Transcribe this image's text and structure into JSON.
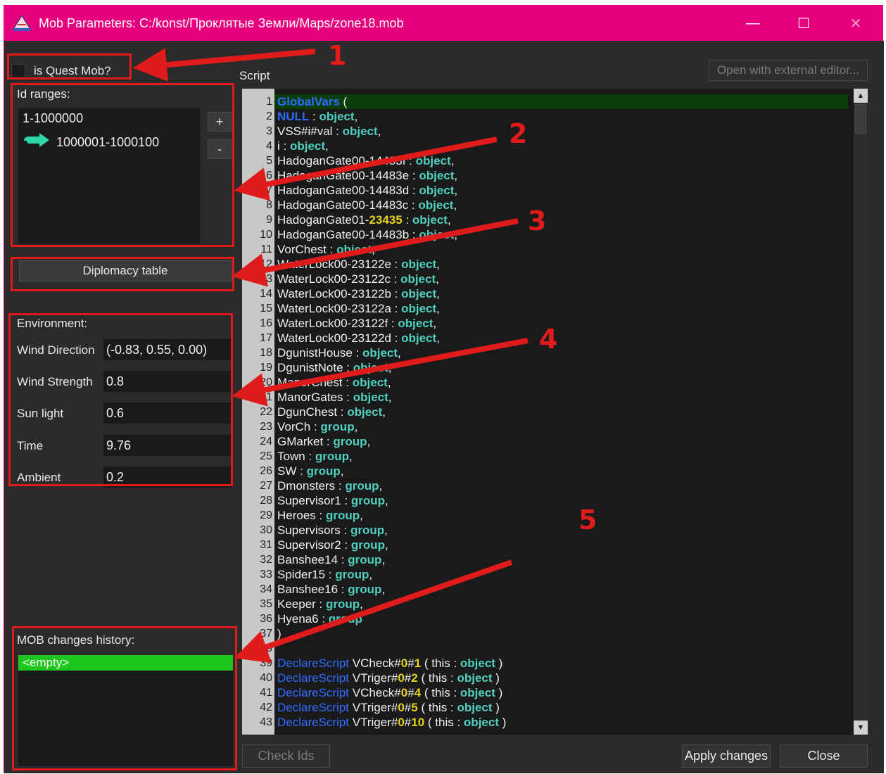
{
  "window": {
    "title": "Mob Parameters: C:/konst/Проклятые Земли/Maps/zone18.mob",
    "controls": {
      "minimize": "—",
      "maximize": "☐",
      "close": "✕"
    },
    "frame_color": "#e6007e"
  },
  "quest": {
    "label": "is Quest Mob?",
    "checked": false
  },
  "id_ranges": {
    "label": "Id ranges:",
    "items": [
      "1-1000000",
      "1000001-1000100"
    ],
    "add_label": "+",
    "remove_label": "-"
  },
  "diplomacy": {
    "label": "Diplomacy table"
  },
  "environment": {
    "label": "Environment:",
    "fields": [
      {
        "label": "Wind Direction",
        "value": "(-0.83, 0.55, 0.00)"
      },
      {
        "label": "Wind Strength",
        "value": "0.8"
      },
      {
        "label": "Sun light",
        "value": "0.6"
      },
      {
        "label": "Time",
        "value": "9.76"
      },
      {
        "label": "Ambient",
        "value": "0.2"
      }
    ]
  },
  "history": {
    "label": "MOB changes history:",
    "items": [
      "<empty>"
    ],
    "selected_color": "#1ec71e"
  },
  "script": {
    "label": "Script",
    "external_editor_label": "Open with external editor...",
    "lines": [
      {
        "n": "1",
        "parts": [
          [
            "kw-blue",
            "GlobalVars"
          ],
          [
            "",
            " ("
          ]
        ]
      },
      {
        "n": "2",
        "parts": [
          [
            "",
            " "
          ],
          [
            "kw-blue",
            "NULL"
          ],
          [
            "",
            " : "
          ],
          [
            "kw-type",
            "object"
          ],
          [
            "",
            ","
          ]
        ]
      },
      {
        "n": "3",
        "parts": [
          [
            "",
            " VSS#i#val : "
          ],
          [
            "kw-type",
            "object"
          ],
          [
            "",
            ","
          ]
        ]
      },
      {
        "n": "4",
        "parts": [
          [
            "",
            " i : "
          ],
          [
            "kw-type",
            "object"
          ],
          [
            "",
            ","
          ]
        ]
      },
      {
        "n": "5",
        "parts": [
          [
            "",
            " HadoganGate00-14483f : "
          ],
          [
            "kw-type",
            "object"
          ],
          [
            "",
            ","
          ]
        ]
      },
      {
        "n": "6",
        "parts": [
          [
            "",
            " HadoganGate00-14483e : "
          ],
          [
            "kw-type",
            "object"
          ],
          [
            "",
            ","
          ]
        ]
      },
      {
        "n": "7",
        "parts": [
          [
            "",
            " HadoganGate00-14483d : "
          ],
          [
            "kw-type",
            "object"
          ],
          [
            "",
            ","
          ]
        ]
      },
      {
        "n": "8",
        "parts": [
          [
            "",
            " HadoganGate00-14483c : "
          ],
          [
            "kw-type",
            "object"
          ],
          [
            "",
            ","
          ]
        ]
      },
      {
        "n": "9",
        "parts": [
          [
            "",
            " HadoganGate01-"
          ],
          [
            "kw-num",
            "23435"
          ],
          [
            "",
            " : "
          ],
          [
            "kw-type",
            "object"
          ],
          [
            "",
            ","
          ]
        ]
      },
      {
        "n": "10",
        "parts": [
          [
            "",
            " HadoganGate00-14483b : "
          ],
          [
            "kw-type",
            "object"
          ],
          [
            "",
            ","
          ]
        ]
      },
      {
        "n": "11",
        "parts": [
          [
            "",
            " VorChest : "
          ],
          [
            "kw-type",
            "object"
          ],
          [
            "",
            ","
          ]
        ]
      },
      {
        "n": "12",
        "parts": [
          [
            "",
            " WaterLock00-23122e : "
          ],
          [
            "kw-type",
            "object"
          ],
          [
            "",
            ","
          ]
        ]
      },
      {
        "n": "13",
        "parts": [
          [
            "",
            " WaterLock00-23122c : "
          ],
          [
            "kw-type",
            "object"
          ],
          [
            "",
            ","
          ]
        ]
      },
      {
        "n": "14",
        "parts": [
          [
            "",
            " WaterLock00-23122b : "
          ],
          [
            "kw-type",
            "object"
          ],
          [
            "",
            ","
          ]
        ]
      },
      {
        "n": "15",
        "parts": [
          [
            "",
            " WaterLock00-23122a : "
          ],
          [
            "kw-type",
            "object"
          ],
          [
            "",
            ","
          ]
        ]
      },
      {
        "n": "16",
        "parts": [
          [
            "",
            " WaterLock00-23122f : "
          ],
          [
            "kw-type",
            "object"
          ],
          [
            "",
            ","
          ]
        ]
      },
      {
        "n": "17",
        "parts": [
          [
            "",
            " WaterLock00-23122d : "
          ],
          [
            "kw-type",
            "object"
          ],
          [
            "",
            ","
          ]
        ]
      },
      {
        "n": "18",
        "parts": [
          [
            "",
            " DgunistHouse : "
          ],
          [
            "kw-type",
            "object"
          ],
          [
            "",
            ","
          ]
        ]
      },
      {
        "n": "19",
        "parts": [
          [
            "",
            " DgunistNote : "
          ],
          [
            "kw-type",
            "object"
          ],
          [
            "",
            ","
          ]
        ]
      },
      {
        "n": "20",
        "parts": [
          [
            "",
            " ManorChest : "
          ],
          [
            "kw-type",
            "object"
          ],
          [
            "",
            ","
          ]
        ]
      },
      {
        "n": "21",
        "parts": [
          [
            "",
            " ManorGates : "
          ],
          [
            "kw-type",
            "object"
          ],
          [
            "",
            ","
          ]
        ]
      },
      {
        "n": "22",
        "parts": [
          [
            "",
            " DgunChest : "
          ],
          [
            "kw-type",
            "object"
          ],
          [
            "",
            ","
          ]
        ]
      },
      {
        "n": "23",
        "parts": [
          [
            "",
            " VorCh : "
          ],
          [
            "kw-type",
            "group"
          ],
          [
            "",
            ","
          ]
        ]
      },
      {
        "n": "24",
        "parts": [
          [
            "",
            " GMarket : "
          ],
          [
            "kw-type",
            "group"
          ],
          [
            "",
            ","
          ]
        ]
      },
      {
        "n": "25",
        "parts": [
          [
            "",
            " Town : "
          ],
          [
            "kw-type",
            "group"
          ],
          [
            "",
            ","
          ]
        ]
      },
      {
        "n": "26",
        "parts": [
          [
            "",
            " SW : "
          ],
          [
            "kw-type",
            "group"
          ],
          [
            "",
            ","
          ]
        ]
      },
      {
        "n": "27",
        "parts": [
          [
            "",
            " Dmonsters : "
          ],
          [
            "kw-type",
            "group"
          ],
          [
            "",
            ","
          ]
        ]
      },
      {
        "n": "28",
        "parts": [
          [
            "",
            " Supervisor1 : "
          ],
          [
            "kw-type",
            "group"
          ],
          [
            "",
            ","
          ]
        ]
      },
      {
        "n": "29",
        "parts": [
          [
            "",
            " Heroes : "
          ],
          [
            "kw-type",
            "group"
          ],
          [
            "",
            ","
          ]
        ]
      },
      {
        "n": "30",
        "parts": [
          [
            "",
            " Supervisors : "
          ],
          [
            "kw-type",
            "group"
          ],
          [
            "",
            ","
          ]
        ]
      },
      {
        "n": "31",
        "parts": [
          [
            "",
            " Supervisor2 : "
          ],
          [
            "kw-type",
            "group"
          ],
          [
            "",
            ","
          ]
        ]
      },
      {
        "n": "32",
        "parts": [
          [
            "",
            " Banshee14 : "
          ],
          [
            "kw-type",
            "group"
          ],
          [
            "",
            ","
          ]
        ]
      },
      {
        "n": "33",
        "parts": [
          [
            "",
            " Spider15 : "
          ],
          [
            "kw-type",
            "group"
          ],
          [
            "",
            ","
          ]
        ]
      },
      {
        "n": "34",
        "parts": [
          [
            "",
            " Banshee16 : "
          ],
          [
            "kw-type",
            "group"
          ],
          [
            "",
            ","
          ]
        ]
      },
      {
        "n": "35",
        "parts": [
          [
            "",
            " Keeper : "
          ],
          [
            "kw-type",
            "group"
          ],
          [
            "",
            ","
          ]
        ]
      },
      {
        "n": "36",
        "parts": [
          [
            "",
            " Hyena6 : "
          ],
          [
            "kw-type",
            "group"
          ]
        ]
      },
      {
        "n": "37",
        "parts": [
          [
            "",
            ")"
          ]
        ]
      },
      {
        "n": "38",
        "parts": []
      },
      {
        "n": "39",
        "parts": [
          [
            "kw-def",
            "DeclareScript"
          ],
          [
            "",
            " VCheck#"
          ],
          [
            "kw-num",
            "0"
          ],
          [
            "",
            "#"
          ],
          [
            "kw-num",
            "1"
          ],
          [
            "",
            " (  this : "
          ],
          [
            "kw-type",
            "object"
          ],
          [
            "",
            " )"
          ]
        ]
      },
      {
        "n": "40",
        "parts": [
          [
            "kw-def",
            "DeclareScript"
          ],
          [
            "",
            " VTriger#"
          ],
          [
            "kw-num",
            "0"
          ],
          [
            "",
            "#"
          ],
          [
            "kw-num",
            "2"
          ],
          [
            "",
            " (  this : "
          ],
          [
            "kw-type",
            "object"
          ],
          [
            "",
            " )"
          ]
        ]
      },
      {
        "n": "41",
        "parts": [
          [
            "kw-def",
            "DeclareScript"
          ],
          [
            "",
            " VCheck#"
          ],
          [
            "kw-num",
            "0"
          ],
          [
            "",
            "#"
          ],
          [
            "kw-num",
            "4"
          ],
          [
            "",
            " (  this : "
          ],
          [
            "kw-type",
            "object"
          ],
          [
            "",
            " )"
          ]
        ]
      },
      {
        "n": "42",
        "parts": [
          [
            "kw-def",
            "DeclareScript"
          ],
          [
            "",
            " VTriger#"
          ],
          [
            "kw-num",
            "0"
          ],
          [
            "",
            "#"
          ],
          [
            "kw-num",
            "5"
          ],
          [
            "",
            " (  this : "
          ],
          [
            "kw-type",
            "object"
          ],
          [
            "",
            " )"
          ]
        ]
      },
      {
        "n": "43",
        "parts": [
          [
            "kw-def",
            "DeclareScript"
          ],
          [
            "",
            " VTriger#"
          ],
          [
            "kw-num",
            "0"
          ],
          [
            "",
            "#"
          ],
          [
            "kw-num",
            "10"
          ],
          [
            "",
            " (  this : "
          ],
          [
            "kw-type",
            "object"
          ],
          [
            "",
            " )"
          ]
        ]
      }
    ]
  },
  "buttons": {
    "check_ids": "Check Ids",
    "apply": "Apply changes",
    "close": "Close"
  },
  "annotations": {
    "numbers": [
      "1",
      "2",
      "3",
      "4",
      "5"
    ],
    "color": "#e01b1b"
  }
}
